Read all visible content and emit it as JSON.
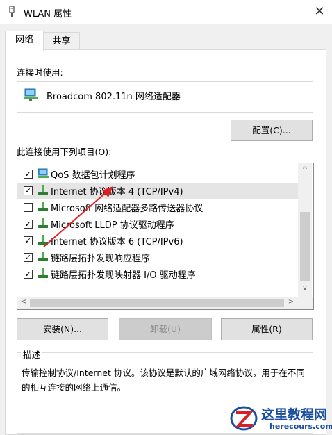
{
  "window": {
    "title": "WLAN 属性",
    "close_glyph": "✕"
  },
  "tabs": [
    {
      "label": "网络",
      "active": true
    },
    {
      "label": "共享",
      "active": false
    }
  ],
  "connect_using": {
    "label": "连接时使用:",
    "adapter_name": "Broadcom 802.11n 网络适配器",
    "configure_label": "配置(C)..."
  },
  "items": {
    "label": "此连接使用下列项目(O):",
    "rows": [
      {
        "checked": true,
        "text": "QoS 数据包计划程序",
        "icon": "qos-icon"
      },
      {
        "checked": true,
        "text": "Internet 协议版本 4 (TCP/IPv4)",
        "icon": "protocol-icon",
        "highlighted": true
      },
      {
        "checked": false,
        "text": "Microsoft 网络适配器多路传送器协议",
        "icon": "protocol-icon"
      },
      {
        "checked": true,
        "text": "Microsoft LLDP 协议驱动程序",
        "icon": "protocol-icon"
      },
      {
        "checked": true,
        "text": "Internet 协议版本 6 (TCP/IPv6)",
        "icon": "protocol-icon"
      },
      {
        "checked": true,
        "text": "链路层拓扑发现响应程序",
        "icon": "protocol-icon"
      },
      {
        "checked": true,
        "text": "链路层拓扑发现映射器 I/O 驱动程序",
        "icon": "protocol-icon"
      }
    ],
    "scroll_up": "^",
    "scroll_down": "v",
    "scroll_left": "<",
    "scroll_right": ">"
  },
  "actions": {
    "install_label": "安装(N)...",
    "uninstall_label": "卸载(U)",
    "properties_label": "属性(R)"
  },
  "description": {
    "legend": "描述",
    "text": "传输控制协议/Internet 协议。该协议是默认的广域网络协议，用于在不同的相互连接的网络上通信。"
  },
  "watermark": {
    "title": "这里教程网",
    "url": "herecours.com"
  },
  "colors": {
    "accent": "#0078d7",
    "annotation_arrow": "#e02020",
    "watermark_blue": "#1a4fa0",
    "watermark_red": "#d71f26"
  }
}
